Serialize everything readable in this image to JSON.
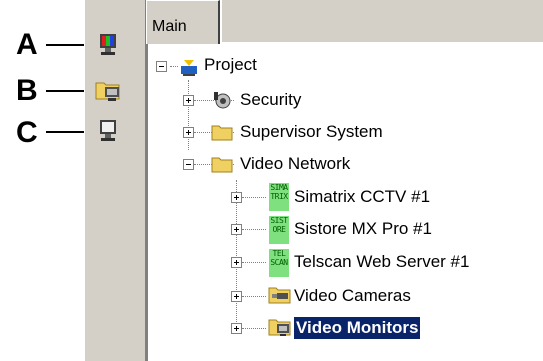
{
  "callouts": [
    "A",
    "B",
    "C"
  ],
  "tabs": {
    "main": "Main"
  },
  "tree": {
    "root": "Project",
    "security": "Security",
    "supervisor": "Supervisor System",
    "video_network": "Video Network",
    "simatrix": {
      "label": "Simatrix CCTV #1",
      "icon_text": [
        "SIMA",
        "TRIX"
      ]
    },
    "sistore": {
      "label": "Sistore MX Pro #1",
      "icon_text": [
        "SIST",
        "ORE"
      ]
    },
    "telscan": {
      "label": "Telscan Web Server #1",
      "icon_text": [
        "TEL",
        "SCAN"
      ]
    },
    "video_cameras": "Video Cameras",
    "video_monitors": "Video Monitors"
  },
  "colors": {
    "selection": "#0a246a",
    "folder": "#f0d060",
    "tag_icon": "#7fe07f"
  }
}
